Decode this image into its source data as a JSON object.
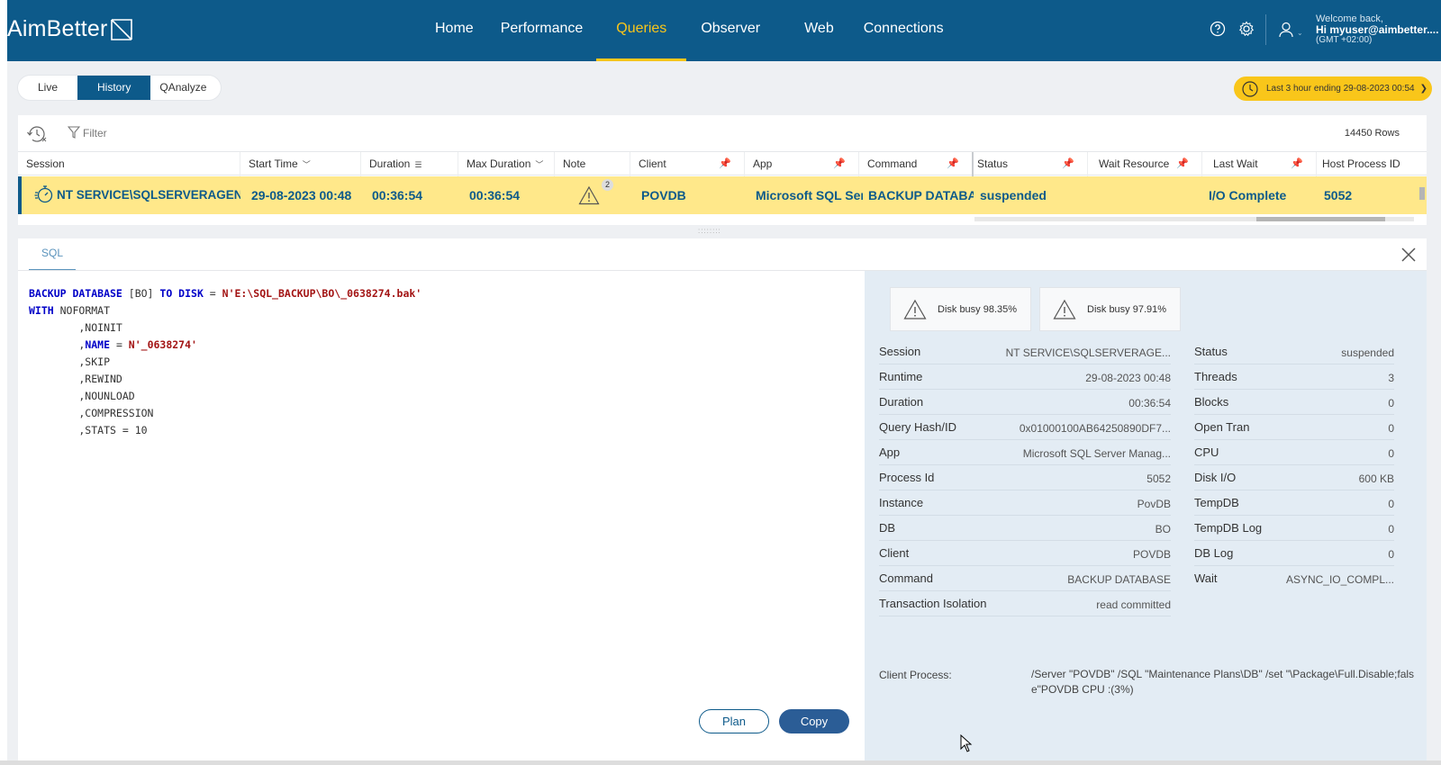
{
  "app": {
    "logo": "AimBetter"
  },
  "nav": {
    "items": [
      {
        "label": "Home",
        "active": false
      },
      {
        "label": "Performance",
        "active": false
      },
      {
        "label": "Queries",
        "active": true
      },
      {
        "label": "Observer",
        "active": false
      },
      {
        "label": "Web",
        "active": false
      },
      {
        "label": "Connections",
        "active": false
      }
    ]
  },
  "user": {
    "welcome": "Welcome back,",
    "name": "Hi myuser@aimbetter....",
    "timezone": "(GMT +02:00)"
  },
  "mode_tabs": {
    "live": "Live",
    "history": "History",
    "qanalyze": "QAnalyze",
    "active": "History"
  },
  "time_range": {
    "label": "Last 3 hour ending  29-08-2023 00:54"
  },
  "grid": {
    "filter_label": "Filter",
    "rows_count": "14450 Rows",
    "columns": [
      "Session",
      "Start Time",
      "Duration",
      "Max Duration",
      "Note",
      "Client",
      "App",
      "Command",
      "Status",
      "Wait Resource",
      "Last Wait",
      "Host Process ID"
    ],
    "row": {
      "session": "NT SERVICE\\SQLSERVERAGEN...",
      "start_time": "29-08-2023 00:48",
      "duration": "00:36:54",
      "max_duration": "00:36:54",
      "note_count": "2",
      "client": "POVDB",
      "app": "Microsoft SQL Server",
      "command": "BACKUP DATABASE",
      "status": "suspended",
      "wait_resource": "",
      "last_wait": "I/O Complete",
      "host_process_id": "5052"
    }
  },
  "detail": {
    "tab": "SQL",
    "sql": {
      "l1_kw1": "BACKUP DATABASE",
      "l1_p1": " [BO] ",
      "l1_kw2": "TO DISK",
      "l1_p2": " = ",
      "l1_str": "N'E:\\SQL_BACKUP\\BO\\_0638274.bak'",
      "l2_kw": "WITH",
      "l2_p": " NOFORMAT",
      "l3": "        ,NOINIT",
      "l4_p": "        ,",
      "l4_kw": "NAME",
      "l4_p2": " = ",
      "l4_str": "N'_0638274'",
      "l5": "        ,SKIP",
      "l6": "        ,REWIND",
      "l7": "        ,NOUNLOAD",
      "l8": "        ,COMPRESSION",
      "l9": "        ,STATS = 10"
    },
    "buttons": {
      "plan": "Plan",
      "copy": "Copy"
    },
    "alerts": [
      "Disk busy 98.35%",
      "Disk busy 97.91%"
    ],
    "left_fields": [
      {
        "k": "Session",
        "v": "NT SERVICE\\SQLSERVERAGE..."
      },
      {
        "k": "Runtime",
        "v": "29-08-2023 00:48"
      },
      {
        "k": "Duration",
        "v": "00:36:54"
      },
      {
        "k": "Query Hash/ID",
        "v": "0x01000100AB64250890DF7..."
      },
      {
        "k": "App",
        "v": "Microsoft SQL Server Manag..."
      },
      {
        "k": "Process Id",
        "v": "5052"
      },
      {
        "k": "Instance",
        "v": "PovDB"
      },
      {
        "k": "DB",
        "v": "BO"
      },
      {
        "k": "Client",
        "v": "POVDB"
      },
      {
        "k": "Command",
        "v": "BACKUP DATABASE"
      },
      {
        "k": "Transaction Isolation",
        "v": "read committed"
      }
    ],
    "right_fields": [
      {
        "k": "Status",
        "v": "suspended"
      },
      {
        "k": "Threads",
        "v": "3"
      },
      {
        "k": "Blocks",
        "v": "0"
      },
      {
        "k": "Open Tran",
        "v": "0"
      },
      {
        "k": "CPU",
        "v": "0"
      },
      {
        "k": "Disk I/O",
        "v": "600 KB"
      },
      {
        "k": "TempDB",
        "v": "0"
      },
      {
        "k": "TempDB Log",
        "v": "0"
      },
      {
        "k": "DB Log",
        "v": "0"
      },
      {
        "k": "Wait",
        "v": "ASYNC_IO_COMPL..."
      }
    ],
    "client_process_label": "Client Process:",
    "client_process_value": "/Server \"POVDB\" /SQL \"Maintenance Plans\\DB\" /set \"\\Package\\Full.Disable;false\"POVDB CPU :(3%)"
  },
  "colors": {
    "brand": "#0d5a8a",
    "accent": "#f9c61a",
    "row_highlight": "#ffe88a"
  }
}
